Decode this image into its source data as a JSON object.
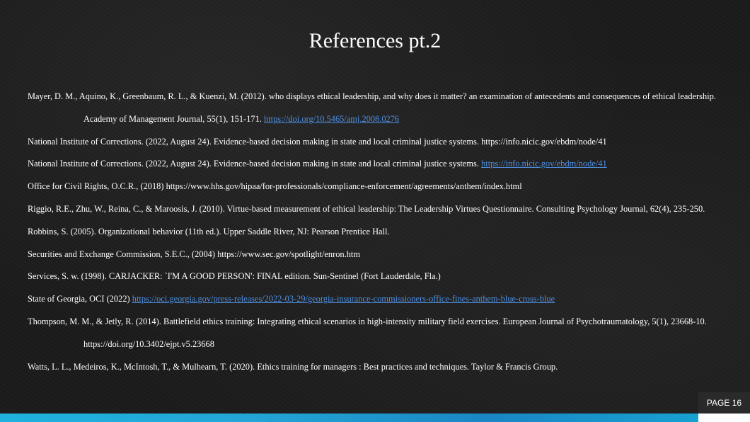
{
  "slide": {
    "title": "References pt.2",
    "page_label": "PAGE 16",
    "accent_color": "#1eb2dc",
    "link_color": "#4f8fe0"
  },
  "references": [
    {
      "text": "Mayer, D. M., Aquino, K., Greenbaum, R. L., & Kuenzi, M. (2012). who displays ethical leadership, and why does it matter? an examination of antecedents and consequences of ethical leadership. Academy of Management Journal, 55(1), 151-171. ",
      "link": "https://doi.org/10.5465/amj.2008.0276"
    },
    {
      "text": "National Institute of Corrections. (2022, August 24). Evidence-based decision making in state and local criminal justice systems. https://info.nicic.gov/ebdm/node/41",
      "link": ""
    },
    {
      "text": "National Institute of Corrections. (2022, August 24). Evidence-based decision making in state and local criminal justice systems. ",
      "link": "https://info.nicic.gov/ebdm/node/41"
    },
    {
      "text": "Office for Civil Rights, O.C.R., (2018) https://www.hhs.gov/hipaa/for-professionals/compliance-enforcement/agreements/anthem/index.html",
      "link": ""
    },
    {
      "text": "Riggio, R.E., Zhu, W., Reina, C., & Maroosis, J. (2010). Virtue-based measurement of ethical leadership: The Leadership Virtues Questionnaire. Consulting Psychology Journal, 62(4), 235-250.",
      "link": ""
    },
    {
      "text": "Robbins, S. (2005). Organizational behavior (11th ed.). Upper Saddle River, NJ: Pearson Prentice Hall.",
      "link": ""
    },
    {
      "text": "Securities and Exchange Commission, S.E.C., (2004) https://www.sec.gov/spotlight/enron.htm",
      "link": ""
    },
    {
      "text": "Services, S. w. (1998). CARJACKER: `I'M A GOOD PERSON': FINAL edition. Sun-Sentinel (Fort Lauderdale, Fla.)",
      "link": ""
    },
    {
      "text": "State of Georgia, OCI (2022) ",
      "link": "https://oci.georgia.gov/press-releases/2022-03-29/georgia-insurance-commissioners-office-fines-anthem-blue-cross-blue"
    },
    {
      "text": "Thompson, M. M., & Jetly, R. (2014). Battlefield ethics training: Integrating ethical scenarios in high-intensity military field exercises. European Journal of Psychotraumatology, 5(1), 23668-10. https://doi.org/10.3402/ejpt.v5.23668",
      "link": ""
    },
    {
      "text": "Watts, L. L., Medeiros, K., McIntosh, T., & Mulhearn, T. (2020). Ethics training for managers : Best practices and techniques. Taylor & Francis Group.",
      "link": ""
    }
  ]
}
